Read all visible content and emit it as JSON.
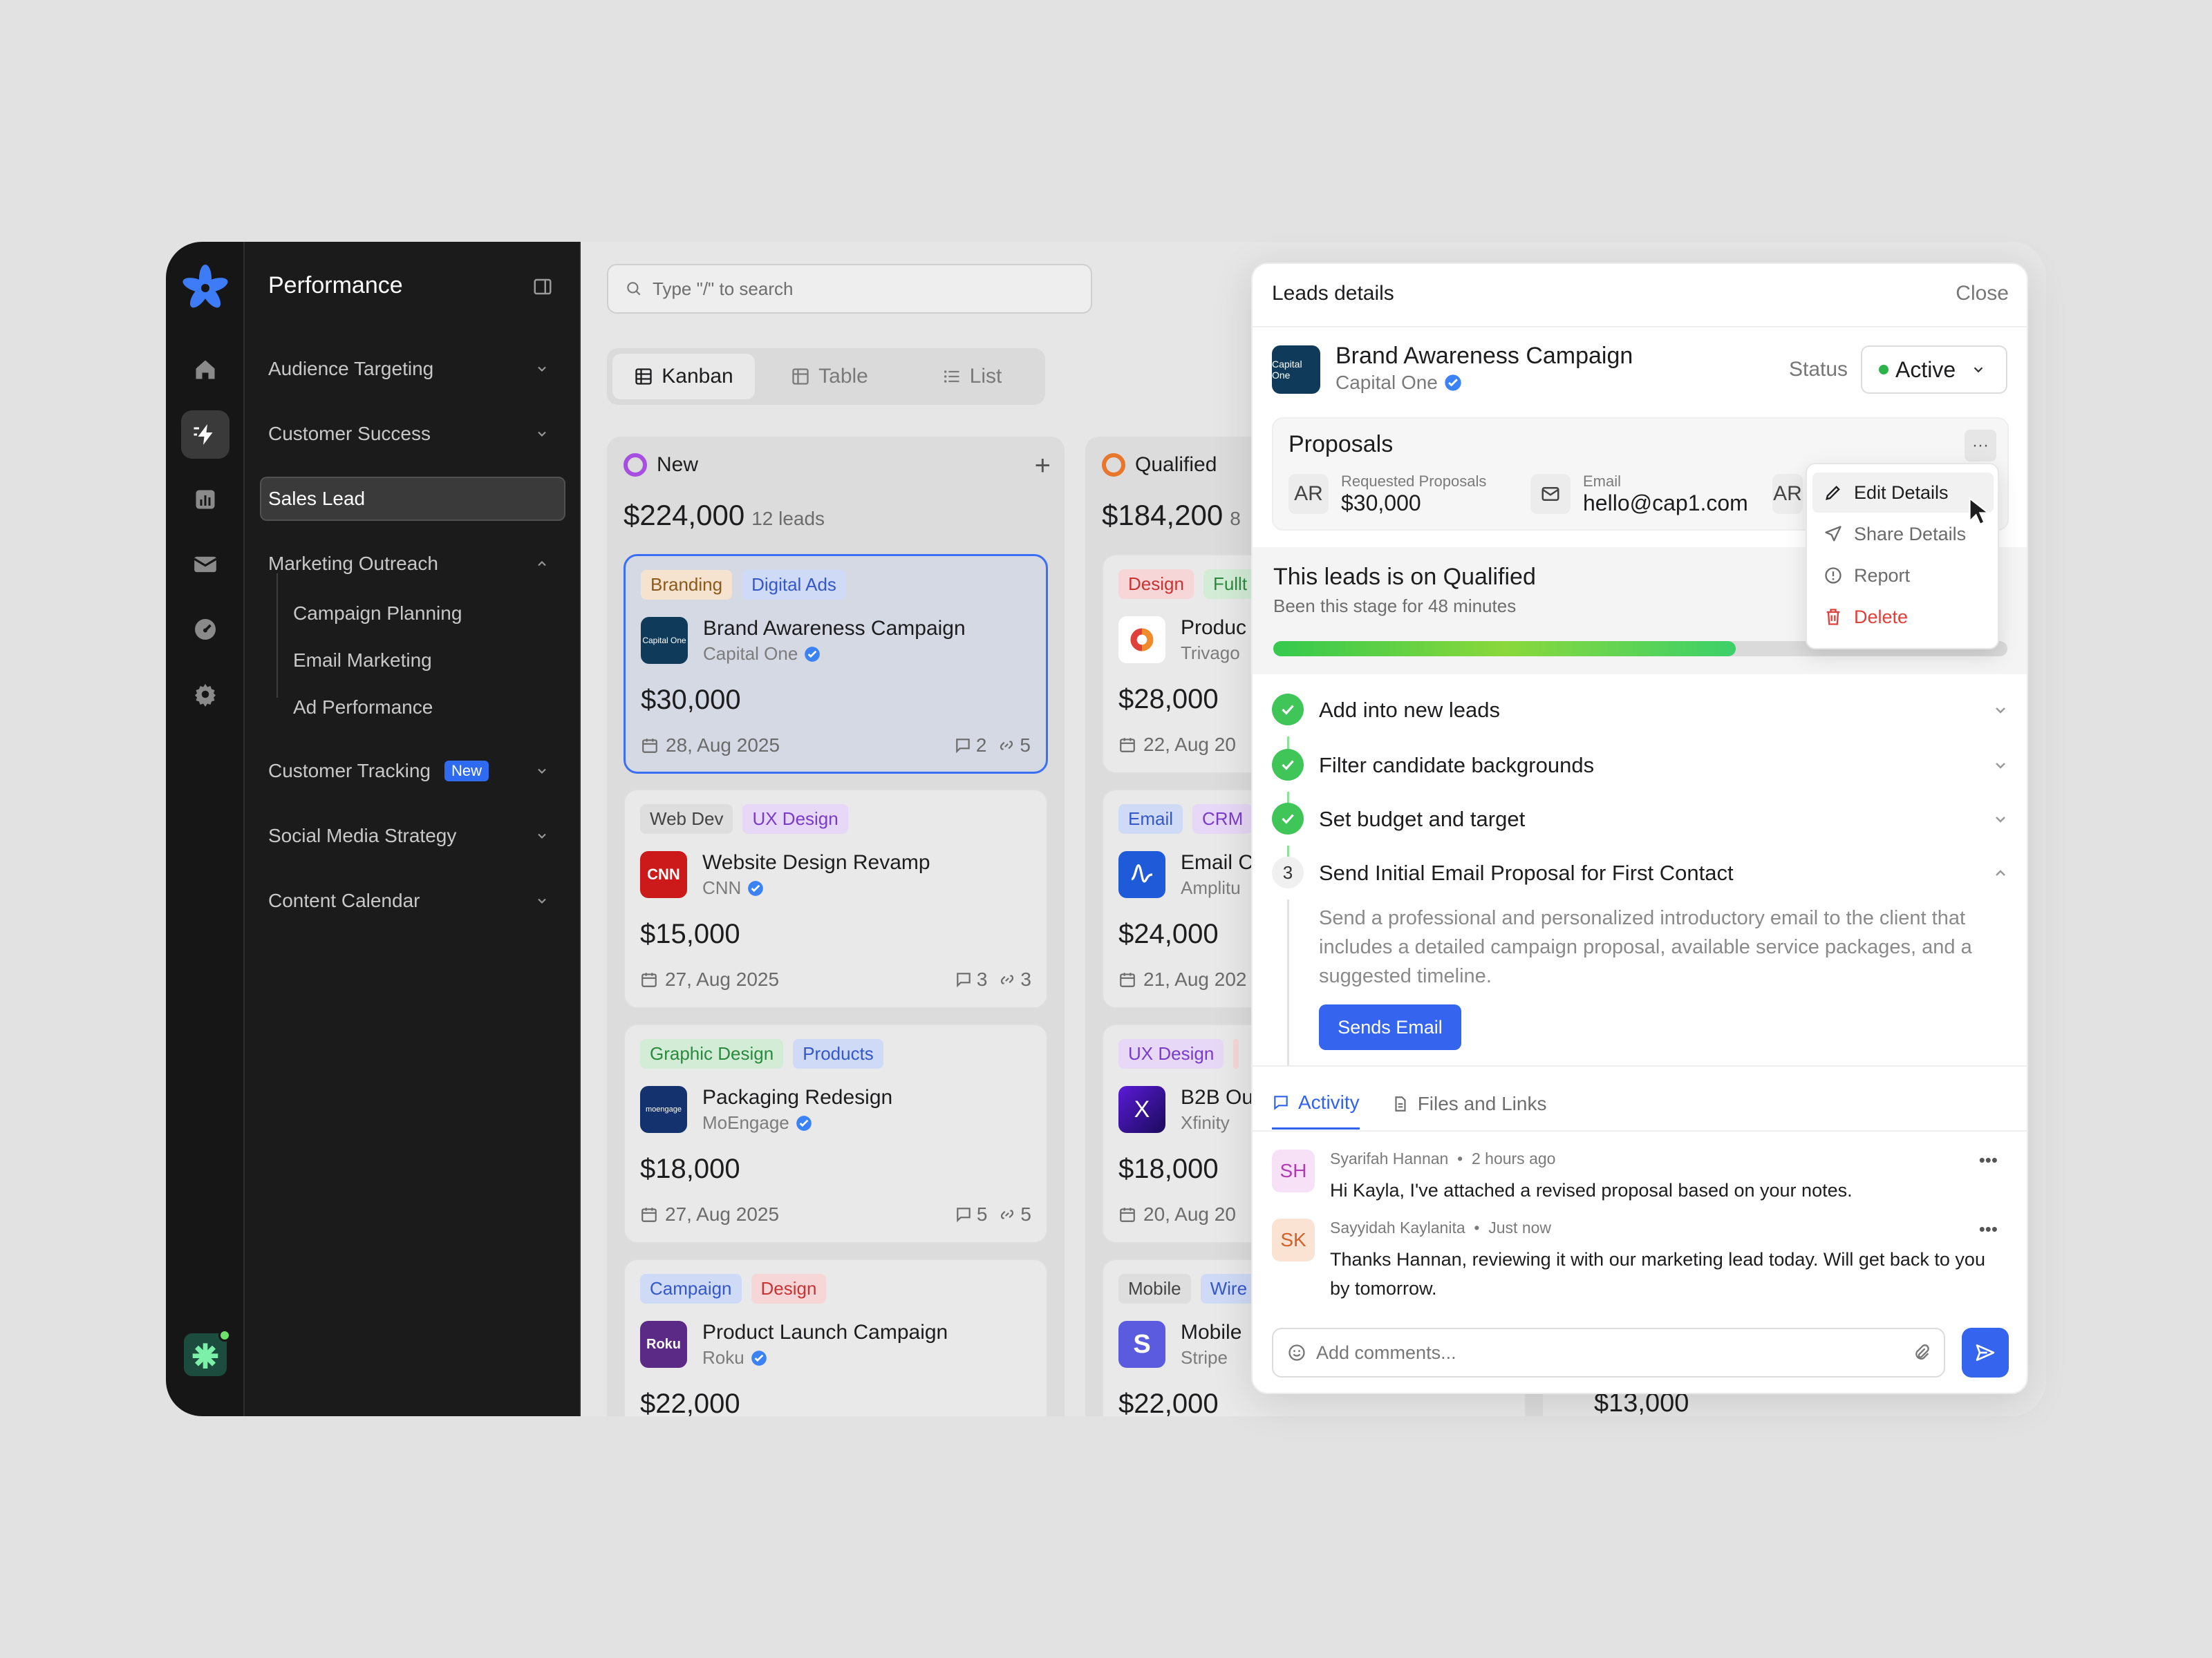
{
  "sidebar": {
    "title": "Performance",
    "items": [
      {
        "label": "Audience Targeting"
      },
      {
        "label": "Customer Success"
      },
      {
        "label": "Sales Lead"
      },
      {
        "label": "Marketing Outreach"
      },
      {
        "label": "Customer Tracking",
        "badge": "New"
      },
      {
        "label": "Social Media Strategy"
      },
      {
        "label": "Content Calendar"
      }
    ],
    "subitems": [
      "Campaign Planning",
      "Email Marketing",
      "Ad Performance"
    ]
  },
  "search": {
    "placeholder": "Type \"/\" to search"
  },
  "views": [
    {
      "label": "Kanban"
    },
    {
      "label": "Table"
    },
    {
      "label": "List"
    }
  ],
  "columns": [
    {
      "name": "New",
      "color": "#a64fe0",
      "total": "$224,000",
      "count": "12 leads",
      "cards": [
        {
          "tags": [
            "Branding",
            "Digital Ads"
          ],
          "title": "Brand Awareness Campaign",
          "company": "Capital One",
          "logo": "Capital One",
          "amount": "$30,000",
          "date": "28, Aug 2025",
          "comments": "2",
          "links": "5"
        },
        {
          "tags": [
            "Web Dev",
            "UX Design"
          ],
          "title": "Website Design Revamp",
          "company": "CNN",
          "logo": "CNN",
          "amount": "$15,000",
          "date": "27, Aug 2025",
          "comments": "3",
          "links": "3"
        },
        {
          "tags": [
            "Graphic Design",
            "Products"
          ],
          "title": "Packaging Redesign",
          "company": "MoEngage",
          "logo": "moengage",
          "amount": "$18,000",
          "date": "27, Aug 2025",
          "comments": "5",
          "links": "5"
        },
        {
          "tags": [
            "Campaign",
            "Design"
          ],
          "title": "Product Launch Campaign",
          "company": "Roku",
          "logo": "Roku",
          "amount": "$22,000"
        }
      ]
    },
    {
      "name": "Qualified",
      "color": "#e8762c",
      "total": "$184,200",
      "count": "8",
      "cards": [
        {
          "tags": [
            "Design",
            "Fullt"
          ],
          "title": "Produc",
          "company": "Trivago",
          "amount": "$28,000",
          "date": "22, Aug 20"
        },
        {
          "tags": [
            "Email",
            "CRM"
          ],
          "title": "Email C",
          "company": "Amplitu",
          "amount": "$24,000",
          "date": "21, Aug 202"
        },
        {
          "tags": [
            "UX Design",
            ""
          ],
          "title": "B2B Ou",
          "company": "Xfinity",
          "logo": "X",
          "amount": "$18,000",
          "date": "20, Aug 20"
        },
        {
          "tags": [
            "Mobile",
            "Wire"
          ],
          "title": "Mobile",
          "company": "Stripe",
          "logo": "S",
          "amount": "$22,000"
        }
      ]
    }
  ],
  "extra_amount": "$13,000",
  "panel": {
    "title": "Leads details",
    "close": "Close",
    "lead_name": "Brand Awareness Campaign",
    "company": "Capital One",
    "logo": "Capital One",
    "status_label": "Status",
    "status": "Active",
    "proposals": {
      "title": "Proposals",
      "more": "···",
      "avatar": "AR",
      "requested_label": "Requested Proposals",
      "requested_value": "$30,000",
      "email_label": "Email",
      "email_value": "hello@cap1.com",
      "avatar2": "AR"
    },
    "stage": {
      "title": "This leads is on Qualified",
      "subtitle": "Been this stage for 48 minutes",
      "progress": 0.63
    },
    "steps": [
      {
        "title": "Add into new leads",
        "done": true
      },
      {
        "title": "Filter candidate backgrounds",
        "done": true
      },
      {
        "title": "Set budget and target",
        "done": true
      },
      {
        "title": "Send Initial Email Proposal for First Contact",
        "number": "3",
        "description": "Send a professional and personalized introductory email to the client that includes a detailed campaign proposal, available service packages, and a suggested timeline.",
        "action": "Sends Email"
      }
    ],
    "tabs": [
      {
        "label": "Activity"
      },
      {
        "label": "Files and Links"
      }
    ],
    "comments": [
      {
        "initials": "SH",
        "author": "Syarifah Hannan",
        "time": "2 hours ago",
        "text": "Hi Kayla, I've attached a revised proposal based on your notes."
      },
      {
        "initials": "SK",
        "author": "Sayyidah Kaylanita",
        "time": "Just now",
        "text": "Thanks Hannan, reviewing it with our marketing lead today. Will get back to you by tomorrow."
      }
    ],
    "comment_placeholder": "Add comments..."
  },
  "menu": [
    {
      "label": "Edit Details"
    },
    {
      "label": "Share Details"
    },
    {
      "label": "Report"
    },
    {
      "label": "Delete"
    }
  ],
  "colors": {
    "accent": "#3564ef",
    "success": "#3fc558",
    "danger": "#e0403a"
  }
}
